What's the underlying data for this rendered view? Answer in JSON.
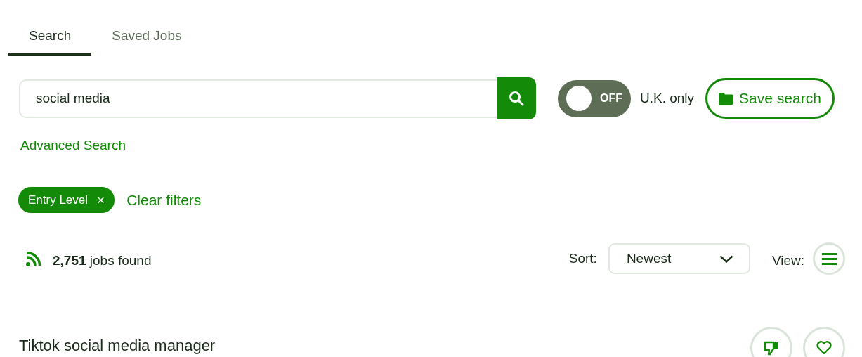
{
  "tabs": [
    {
      "label": "Search",
      "selected": true
    },
    {
      "label": "Saved Jobs",
      "selected": false
    }
  ],
  "search": {
    "value": "social media"
  },
  "uk_toggle": {
    "on": false,
    "state_label": "OFF",
    "label": "U.K. only"
  },
  "save_search": "Save search",
  "advanced_search": "Advanced Search",
  "filters": [
    {
      "label": "Entry Level",
      "remove": "×"
    }
  ],
  "clear_filters": "Clear filters",
  "results_count": "**2,751** jobs found",
  "sort": {
    "label": "Sort:",
    "value": "Newest"
  },
  "view": {
    "label": "View:"
  },
  "jobs": [
    {
      "title": "Tiktok social media manager"
    }
  ]
}
